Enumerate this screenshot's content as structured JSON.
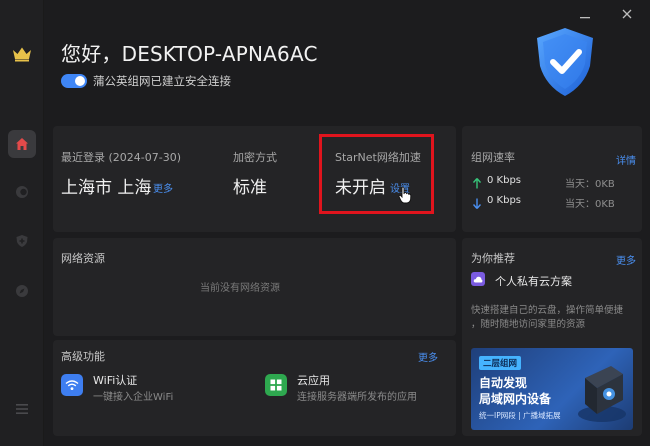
{
  "app": {
    "greeting": "您好，DESKTOP-APNA6AC",
    "secure_status": "蒲公英组网已建立安全连接"
  },
  "login": {
    "label": "最近登录",
    "date": "(2024-07-30)",
    "location": "上海市 上海",
    "more": "更多"
  },
  "encryption": {
    "label": "加密方式",
    "value": "标准"
  },
  "starnet": {
    "label": "StarNet网络加速",
    "value": "未开启",
    "settings": "设置"
  },
  "speed": {
    "title": "组网速率",
    "details": "详情",
    "upload": "0 Kbps",
    "download": "0 Kbps",
    "upload_today": "当天：0KB",
    "download_today": "当天：0KB"
  },
  "resources": {
    "title": "网络资源",
    "empty": "当前没有网络资源"
  },
  "advanced": {
    "title": "高级功能",
    "more": "更多",
    "items": [
      {
        "name": "WiFi认证",
        "desc": "一键接入企业WiFi",
        "icon": "wifi-icon",
        "color": "#3e7ef0"
      },
      {
        "name": "云应用",
        "desc": "连接服务器端所发布的应用",
        "icon": "apps-grid-icon",
        "color": "#2ea84f"
      }
    ]
  },
  "recommend": {
    "title": "为你推荐",
    "more": "更多",
    "item_title": "个人私有云方案",
    "item_desc_1": "快速搭建自己的云盘，操作简单便捷",
    "item_desc_2": "，随时随地访问家里的资源"
  },
  "banner": {
    "tag": "二层组网",
    "line1": "自动发现",
    "line2": "局域网内设备",
    "foot_a": "统一IP网段",
    "foot_b": "广播域拓展"
  }
}
